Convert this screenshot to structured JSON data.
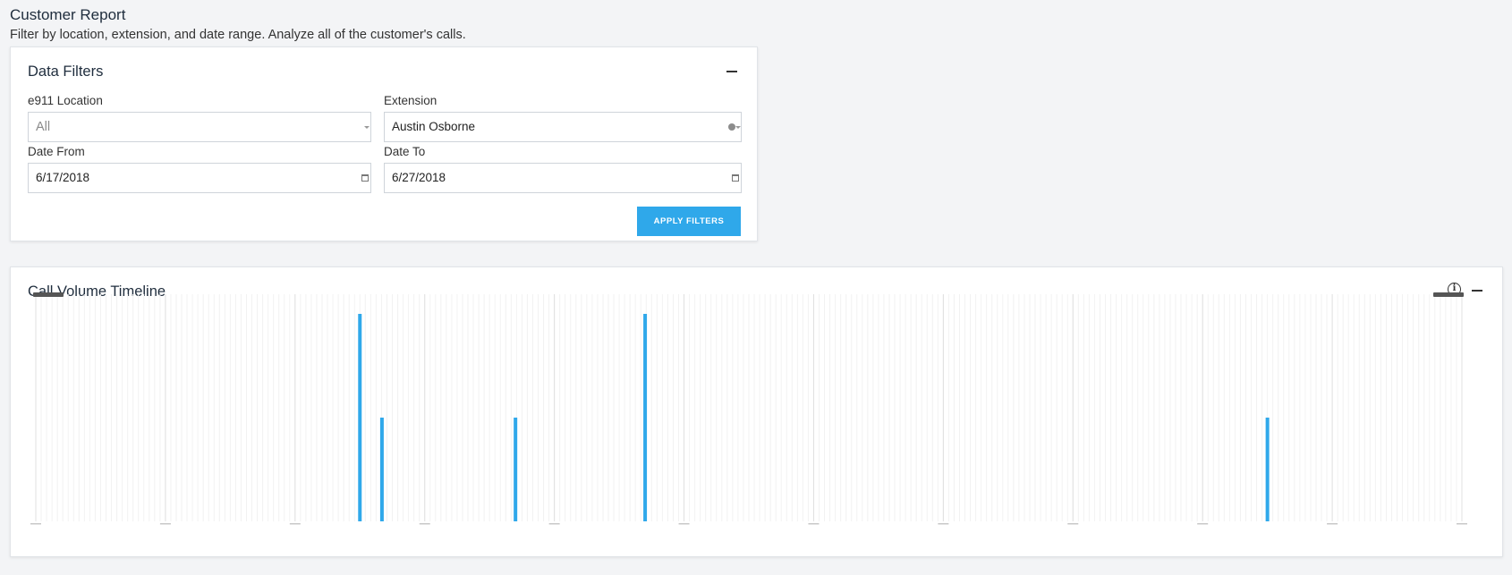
{
  "page": {
    "title": "Customer Report",
    "subtitle": "Filter by location, extension, and date range. Analyze all of the customer's calls."
  },
  "filters": {
    "card_title": "Data Filters",
    "location": {
      "label": "e911 Location",
      "value": "All"
    },
    "extension": {
      "label": "Extension",
      "value": "Austin Osborne"
    },
    "date_from": {
      "label": "Date From",
      "value": "6/17/2018"
    },
    "date_to": {
      "label": "Date To",
      "value": "6/27/2018"
    },
    "apply_label": "APPLY FILTERS"
  },
  "timeline": {
    "card_title": "Call Volume Timeline"
  },
  "colors": {
    "accent": "#2fa8ea",
    "bar": "#2fa8ea"
  },
  "chart_data": {
    "type": "bar",
    "x_range_days": [
      0,
      11
    ],
    "ylim": [
      0,
      2
    ],
    "values": [
      {
        "day": 2.5,
        "value": 2
      },
      {
        "day": 2.67,
        "value": 1
      },
      {
        "day": 3.7,
        "value": 1
      },
      {
        "day": 4.7,
        "value": 2
      },
      {
        "day": 9.5,
        "value": 1
      }
    ],
    "grid": true
  }
}
